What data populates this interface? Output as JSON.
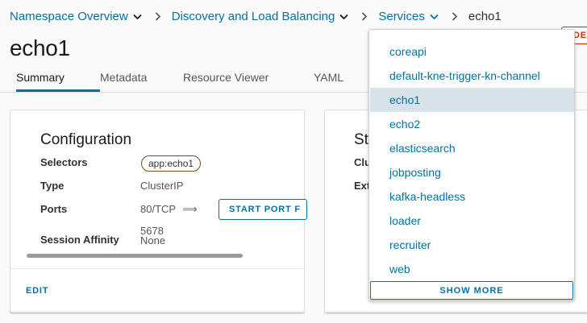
{
  "breadcrumb": {
    "items": [
      "Namespace Overview",
      "Discovery and Load Balancing",
      "Services"
    ],
    "current": "echo1"
  },
  "page": {
    "title": "echo1",
    "delete_label": "DEL"
  },
  "tabs": [
    "Summary",
    "Metadata",
    "Resource Viewer",
    "YAML"
  ],
  "config_card": {
    "title": "Configuration",
    "selectors_label": "Selectors",
    "selector_value": "app:echo1",
    "type_label": "Type",
    "type_value": "ClusterIP",
    "ports_label": "Ports",
    "port_value": "80/TCP",
    "port_arrow": "⟹",
    "target_port": "5678",
    "start_port_button": "START PORT F",
    "session_label": "Session Affinity",
    "session_value": "None",
    "edit_label": "EDIT"
  },
  "status_card": {
    "title_partial": "St",
    "row1_partial": "Clu",
    "row2_partial": "Ext"
  },
  "services_dropdown": {
    "items": [
      "coreapi",
      "default-kne-trigger-kn-channel",
      "echo1",
      "echo2",
      "elasticsearch",
      "jobposting",
      "kafka-headless",
      "loader",
      "recruiter",
      "web"
    ],
    "selected": "echo1",
    "show_more_label": "SHOW MORE"
  },
  "colors": {
    "link": "#0072a3",
    "danger": "#e12200",
    "selected_bg": "#d8e3e9"
  }
}
